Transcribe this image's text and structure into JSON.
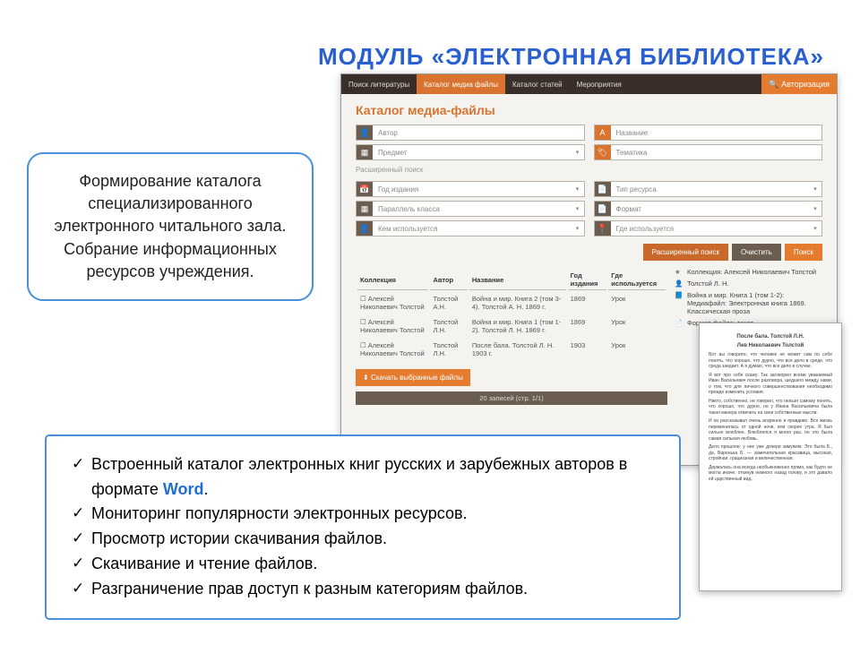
{
  "slide_title": "МОДУЛЬ «ЭЛЕКТРОННАЯ БИБЛИОТЕКА»",
  "callout_top": "Формирование каталога специализированного электронного читального зала. Собрание информационных ресурсов учреждения.",
  "bullets": [
    {
      "pre": "Встроенный каталог электронных книг русских и зарубежных авторов в формате ",
      "word": "Word",
      "post": "."
    },
    {
      "pre": "Мониторинг популярности электронных ресурсов.",
      "word": "",
      "post": ""
    },
    {
      "pre": "Просмотр истории скачивания файлов.",
      "word": "",
      "post": ""
    },
    {
      "pre": "Скачивание  и чтение файлов.",
      "word": "",
      "post": ""
    },
    {
      "pre": "Разграничение прав доступ к разным категориям файлов.",
      "word": "",
      "post": ""
    }
  ],
  "nav": {
    "tabs": [
      "Поиск литературы",
      "Каталог медиа файлы",
      "Каталог статей",
      "Мероприятия"
    ],
    "active_index": 1,
    "auth": "Авторизация"
  },
  "page_heading": "Каталог медиа-файлы",
  "fields_top": [
    {
      "icon": "user",
      "label": "Автор",
      "dd": false,
      "orange": false
    },
    {
      "icon": "A",
      "label": "Название",
      "dd": false,
      "orange": true
    },
    {
      "icon": "grid",
      "label": "Предмет",
      "dd": true,
      "orange": false
    },
    {
      "icon": "tag",
      "label": "Тематика",
      "dd": false,
      "orange": true
    }
  ],
  "adv_label": "Расширенный поиск",
  "fields_adv": [
    {
      "icon": "cal",
      "label": "Год издания",
      "dd": true
    },
    {
      "icon": "doc",
      "label": "Тип ресурса",
      "dd": true
    },
    {
      "icon": "grid",
      "label": "Параллель класса",
      "dd": true
    },
    {
      "icon": "doc",
      "label": "Формат",
      "dd": true
    },
    {
      "icon": "user",
      "label": "Кем используется",
      "dd": true
    },
    {
      "icon": "loc",
      "label": "Где используется",
      "dd": true
    }
  ],
  "buttons": {
    "search": "Расширенный поиск",
    "clear": "Очистить",
    "find": "Поиск"
  },
  "table": {
    "headers": [
      "Коллекция",
      "Автор",
      "Название",
      "Год издания",
      "Где используется"
    ],
    "rows": [
      {
        "c": "Алексей Николаевич Толстой",
        "a": "Толстой А.Н.",
        "n": "Война и мир. Книга 2 (том 3-4). Толстой А. Н. 1869 г.",
        "y": "1869",
        "w": "Урок"
      },
      {
        "c": "Алексей Николаевич Толстой",
        "a": "Толстой Л.Н.",
        "n": "Война и мир. Книга 1 (том 1-2). Толстой Л. Н. 1869 г.",
        "y": "1869",
        "w": "Урок"
      },
      {
        "c": "Алексей Николаевич Толстой",
        "a": "Толстой Л.Н.",
        "n": "После бала. Толстой Л. Н. 1903 г.",
        "y": "1903",
        "w": "Урок"
      }
    ]
  },
  "download_btn": "Скачать выбранные файлы",
  "pager": "20 записей (стр. 1/1)",
  "side_filters": [
    {
      "i": "★",
      "t": "Коллекция: Алексей Николаевич Толстой"
    },
    {
      "i": "👤",
      "t": "Толстой Л. Н."
    },
    {
      "i": "📘",
      "t": "Война и мир. Книга 1 (том 1-2): Медиафайл: Электронная книга 1869. Классическая проза"
    },
    {
      "i": "📄",
      "t": "Формат файла: текст"
    }
  ],
  "doc": {
    "title": "После бала. Толстой Л.Н.",
    "subtitle": "Лев Николаевич Толстой",
    "paras": [
      "Вот вы говорите, что человек не может сам по себе понять, что хорошо, что дурно, что все дело в среде, что среда заедает. А я думаю, что все дело в случае.",
      "Я вот про себя скажу. Так заговорил всеми уважаемый Иван Васильевич после разговора, шедшего между нами, о том, что для личного совершенствования необходимо прежде изменить условия.",
      "Никто, собственно, не говорил, что нельзя самому понять, что хорошо, что дурно, но у Ивана Васильевича была такая манера отвечать на свои собственные мысли.",
      "И он рассказывал очень искренно и правдиво. Вся жизнь переменилась от одной ночи, или скорее утра. Я был сильно влюблен. Влюблялся я много раз, но это была самая сильная любовь.",
      "Дело прошлое; у нее уже дочери замужем. Это была Б., да, Варенька Б. — замечательная красавица, высокая, стройная, грациозная и величественная.",
      "Держалась она всегда необыкновенно прямо, как будто не могла иначе, откинув немного назад голову, и это давало ей царственный вид."
    ]
  },
  "icons": {
    "user": "👤",
    "A": "A",
    "grid": "▦",
    "tag": "🏷",
    "cal": "📅",
    "doc": "📄",
    "loc": "📍",
    "search": "🔍",
    "download": "⬇"
  }
}
